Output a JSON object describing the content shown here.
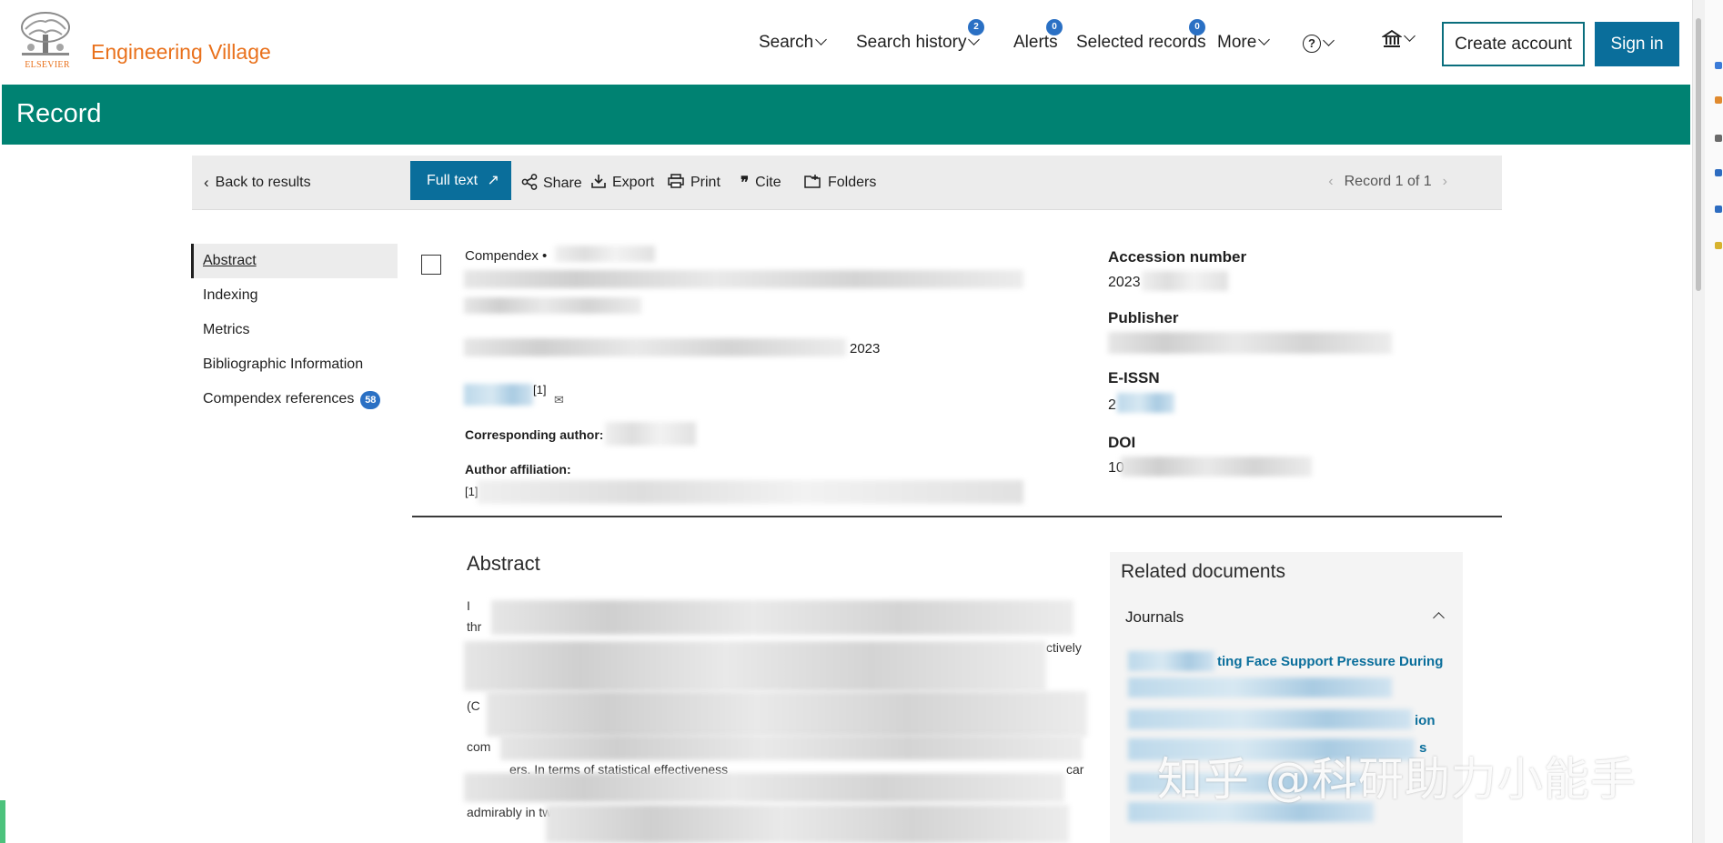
{
  "header": {
    "logo_text": "ELSEVIER",
    "brand": "Engineering Village",
    "nav": {
      "search": "Search",
      "search_history": "Search history",
      "search_history_count": "2",
      "alerts": "Alerts",
      "alerts_count": "0",
      "selected_records": "Selected records",
      "selected_records_count": "0",
      "more": "More"
    },
    "create_account": "Create account",
    "sign_in": "Sign in"
  },
  "banner": {
    "title": "Record"
  },
  "toolbar": {
    "back": "Back to results",
    "full_text": "Full text",
    "share": "Share",
    "export": "Export",
    "print": "Print",
    "cite": "Cite",
    "folders": "Folders",
    "record_position": "Record 1 of 1"
  },
  "section_nav": {
    "items": [
      {
        "label": "Abstract"
      },
      {
        "label": "Indexing"
      },
      {
        "label": "Metrics"
      },
      {
        "label": "Bibliographic Information"
      },
      {
        "label": "Compendex references",
        "count": "58"
      }
    ]
  },
  "record": {
    "database": "Compendex",
    "source_year": "2023",
    "author_ref": "[1]",
    "corresponding_author_label": "Corresponding author:",
    "author_affiliation_label": "Author affiliation:",
    "affiliation_ref": "[1]"
  },
  "metadata": {
    "accession_number_label": "Accession number",
    "accession_number_value": "2023",
    "publisher_label": "Publisher",
    "eissn_label": "E-ISSN",
    "eissn_value": "2",
    "doi_label": "DOI",
    "doi_value": "10"
  },
  "abstract": {
    "title": "Abstract",
    "fragments": [
      "I",
      "thr",
      "ctively",
      "(C",
      "com",
      "ers. In terms of statistical effectiveness",
      "car",
      "admirably in tw"
    ]
  },
  "related": {
    "title": "Related documents",
    "section": "Journals",
    "links": [
      "ting Face Support Pressure During",
      "ion",
      "s"
    ]
  },
  "watermark": "知乎 @科研助力小能手",
  "colors": {
    "brand_orange": "#e9711c",
    "banner_green": "#008272",
    "primary_blue": "#0a6e9b",
    "badge_blue": "#2a70c4"
  }
}
